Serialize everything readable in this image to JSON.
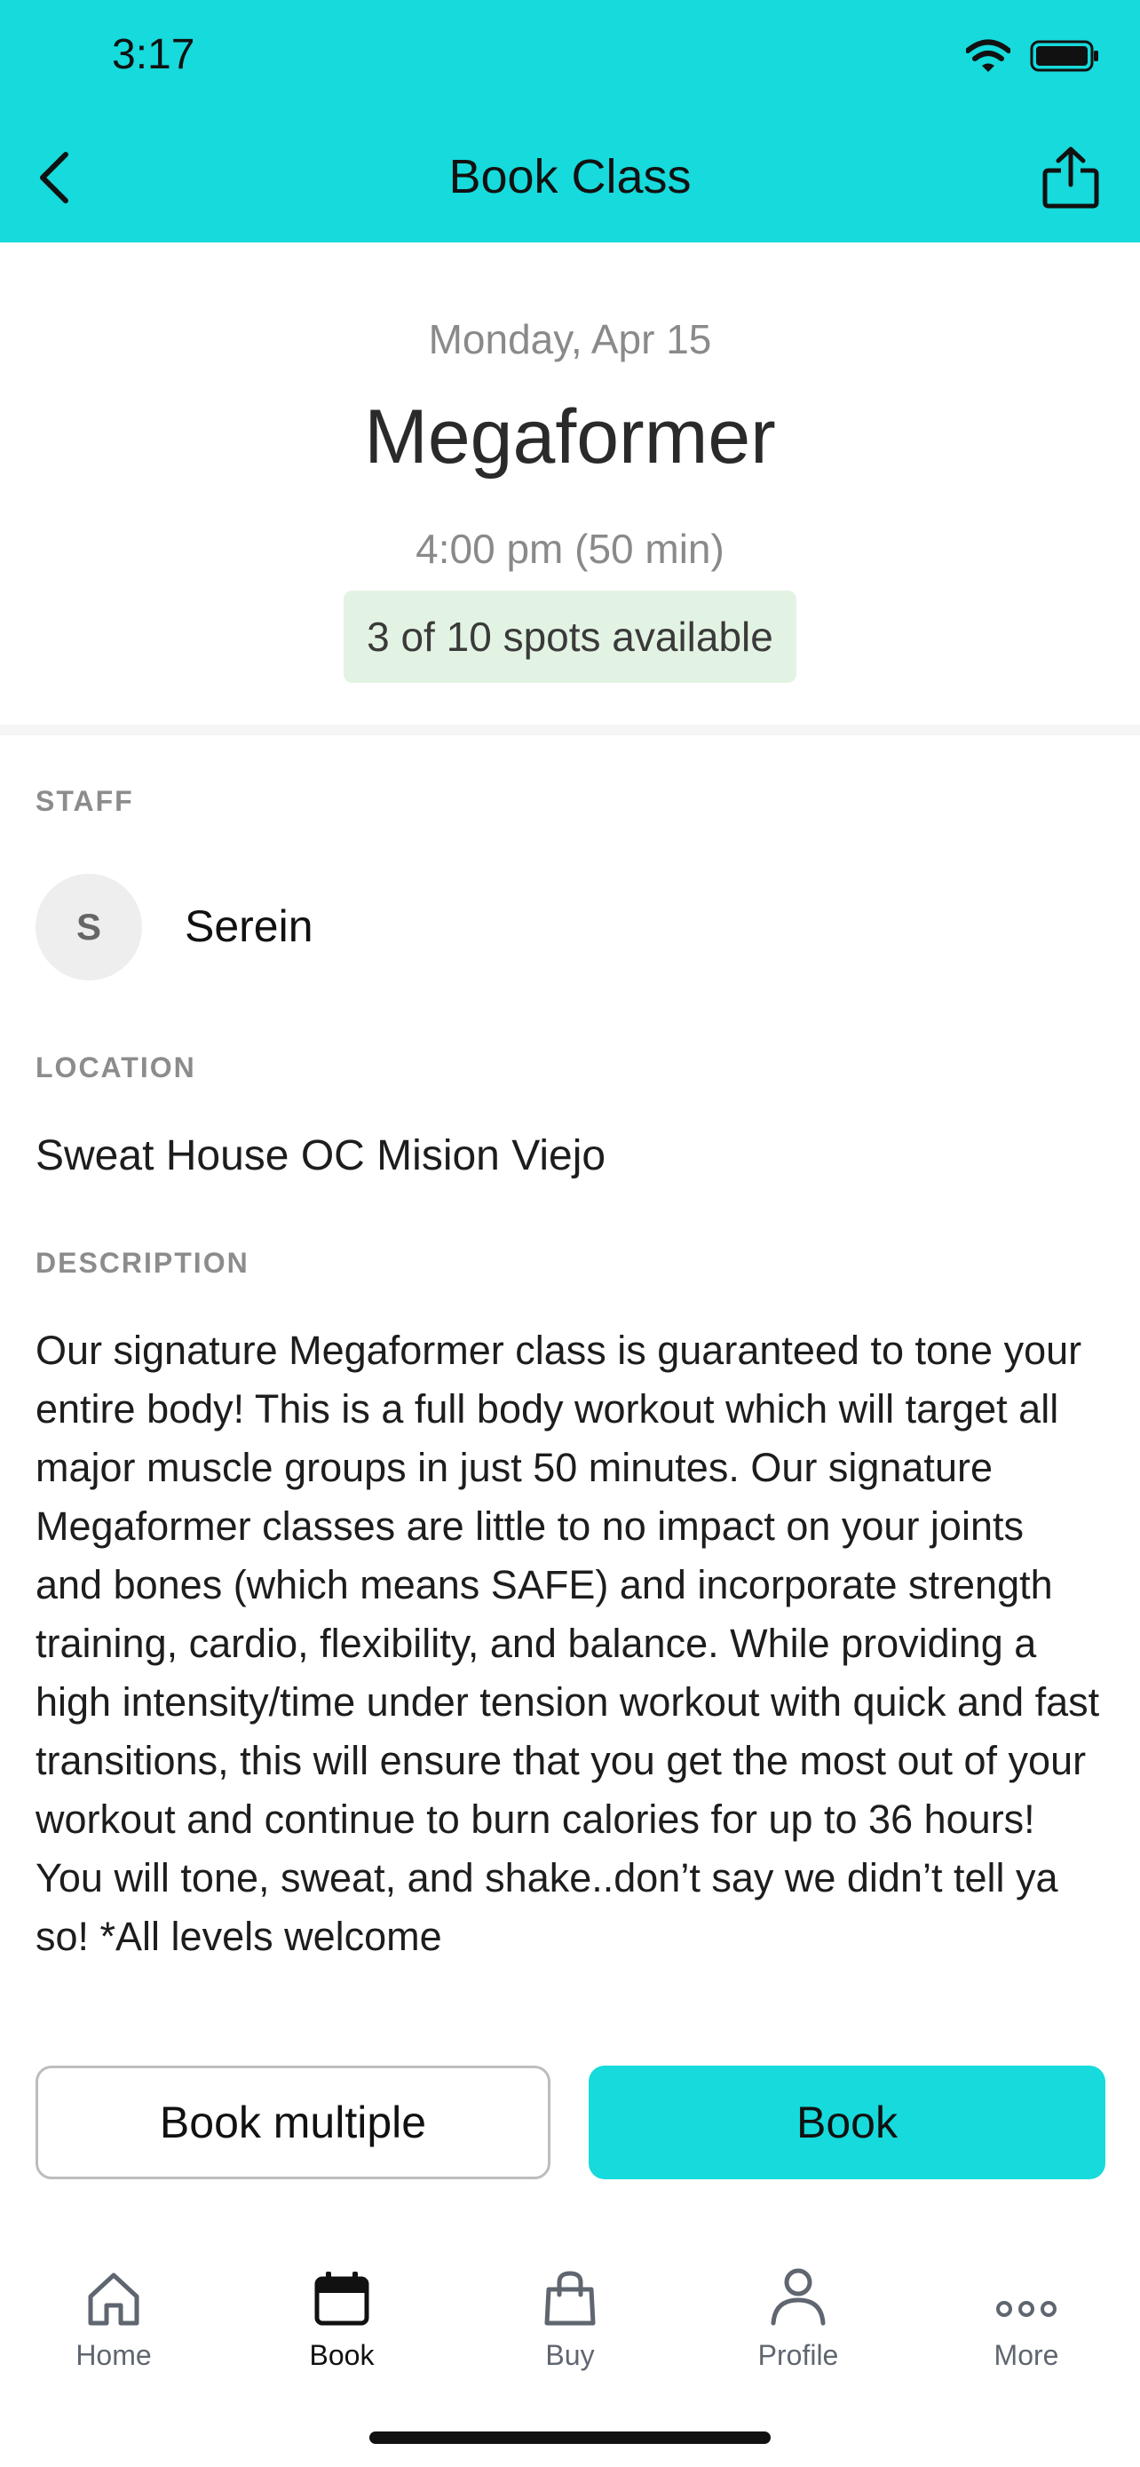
{
  "status_bar": {
    "time": "3:17"
  },
  "nav": {
    "title": "Book Class"
  },
  "class": {
    "date": "Monday, Apr 15",
    "name": "Megaformer",
    "time": "4:00 pm (50 min)",
    "spots": "3 of 10 spots available"
  },
  "staff": {
    "label": "STAFF",
    "initial": "S",
    "name": "Serein"
  },
  "location": {
    "label": "LOCATION",
    "name": "Sweat House OC Mision Viejo"
  },
  "description": {
    "label": "DESCRIPTION",
    "text": "Our signature Megaformer class is guaranteed to tone your entire body! This is a full body workout which will target all major muscle groups in just 50 minutes. Our signature Megaformer classes are little to no impact on your joints and bones (which means SAFE) and incorporate strength training, cardio, flexibility, and balance. While providing a high intensity/time under tension workout with quick and fast transitions, this will ensure that you get the most out of your workout and continue to burn calories for up to 36 hours! You will tone, sweat, and shake..don’t say we didn’t tell ya so! *All levels welcome"
  },
  "actions": {
    "book_multiple": "Book multiple",
    "book": "Book"
  },
  "tabs": [
    {
      "label": "Home",
      "icon": "home-icon"
    },
    {
      "label": "Book",
      "icon": "calendar-icon",
      "active": true
    },
    {
      "label": "Buy",
      "icon": "shopping-bag-icon"
    },
    {
      "label": "Profile",
      "icon": "person-icon"
    },
    {
      "label": "More",
      "icon": "more-icon"
    }
  ],
  "colors": {
    "accent": "#16dadb",
    "spots_bg": "#e3f3e3",
    "muted_text": "#8a8a8a"
  }
}
